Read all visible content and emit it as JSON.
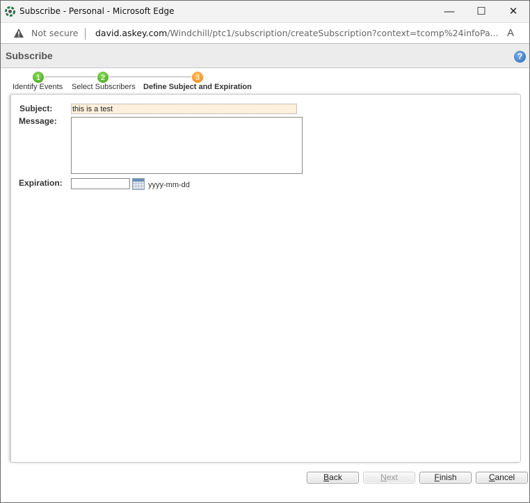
{
  "window": {
    "title": "Subscribe - Personal - Microsoft Edge",
    "minimize": "—",
    "maximize": "☐",
    "close": "✕"
  },
  "address": {
    "security": "Not secure",
    "domain": "david.askey.com",
    "path": "/Windchill/ptc1/subscription/createSubscription?context=tcomp%24infoPa...",
    "read_aloud": "A"
  },
  "header": {
    "title": "Subscribe",
    "help": "?"
  },
  "steps": [
    {
      "num": "1",
      "label": "Identify Events"
    },
    {
      "num": "2",
      "label": "Select Subscribers"
    },
    {
      "num": "3",
      "label": "Define Subject and Expiration"
    }
  ],
  "form": {
    "subject_label": "Subject:",
    "subject_value": "this is a test",
    "message_label": "Message:",
    "message_value": "",
    "expiration_label": "Expiration:",
    "expiration_value": "",
    "date_format": "yyyy-mm-dd"
  },
  "buttons": {
    "back": {
      "k": "B",
      "rest": "ack"
    },
    "next": {
      "k": "N",
      "rest": "ext"
    },
    "finish": {
      "k": "F",
      "rest": "inish"
    },
    "cancel": {
      "k": "C",
      "rest": "ancel"
    }
  }
}
